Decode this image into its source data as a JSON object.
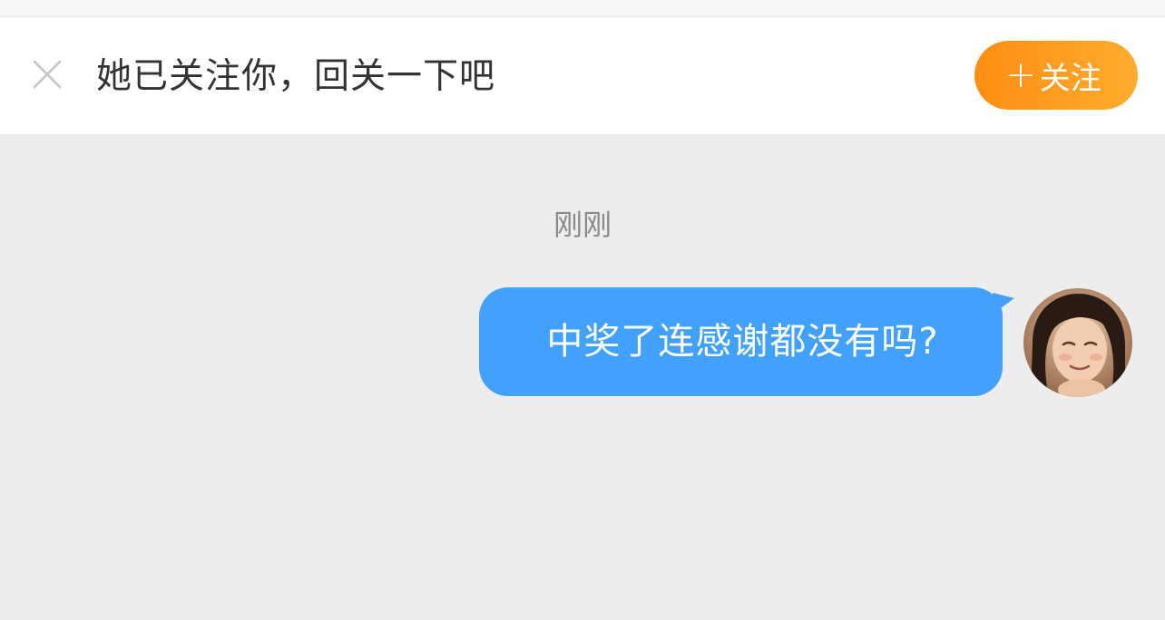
{
  "banner": {
    "message": "她已关注你，回关一下吧",
    "follow_button": {
      "icon": "plus-icon",
      "label": "关注",
      "color_start": "#ff8e14",
      "color_end": "#ffac2e"
    },
    "close_icon": "close-icon"
  },
  "chat": {
    "timestamp": "刚刚",
    "messages": [
      {
        "text": "中奖了连感谢都没有吗?",
        "from": "self",
        "bubble_color": "#41a1fd"
      }
    ],
    "avatar": "user-avatar"
  }
}
